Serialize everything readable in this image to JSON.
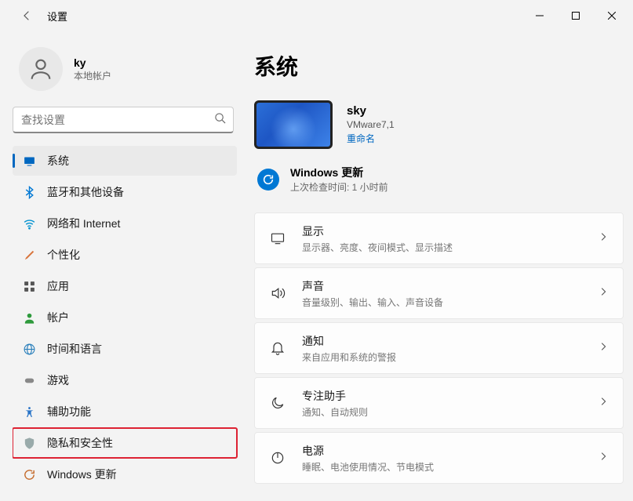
{
  "window": {
    "title": "设置"
  },
  "profile": {
    "name": "ky",
    "sub": "本地帐户"
  },
  "search": {
    "placeholder": "查找设置"
  },
  "nav": [
    {
      "label": "系统"
    },
    {
      "label": "蓝牙和其他设备"
    },
    {
      "label": "网络和 Internet"
    },
    {
      "label": "个性化"
    },
    {
      "label": "应用"
    },
    {
      "label": "帐户"
    },
    {
      "label": "时间和语言"
    },
    {
      "label": "游戏"
    },
    {
      "label": "辅助功能"
    },
    {
      "label": "隐私和安全性"
    },
    {
      "label": "Windows 更新"
    }
  ],
  "main": {
    "title": "系统",
    "device": {
      "name": "sky",
      "model": "VMware7,1",
      "rename": "重命名"
    },
    "update": {
      "title": "Windows 更新",
      "sub": "上次检查时间: 1 小时前"
    },
    "cards": [
      {
        "title": "显示",
        "sub": "显示器、亮度、夜间模式、显示描述"
      },
      {
        "title": "声音",
        "sub": "音量级别、输出、输入、声音设备"
      },
      {
        "title": "通知",
        "sub": "来自应用和系统的警报"
      },
      {
        "title": "专注助手",
        "sub": "通知、自动规则"
      },
      {
        "title": "电源",
        "sub": "睡眠、电池使用情况、节电模式"
      }
    ]
  }
}
